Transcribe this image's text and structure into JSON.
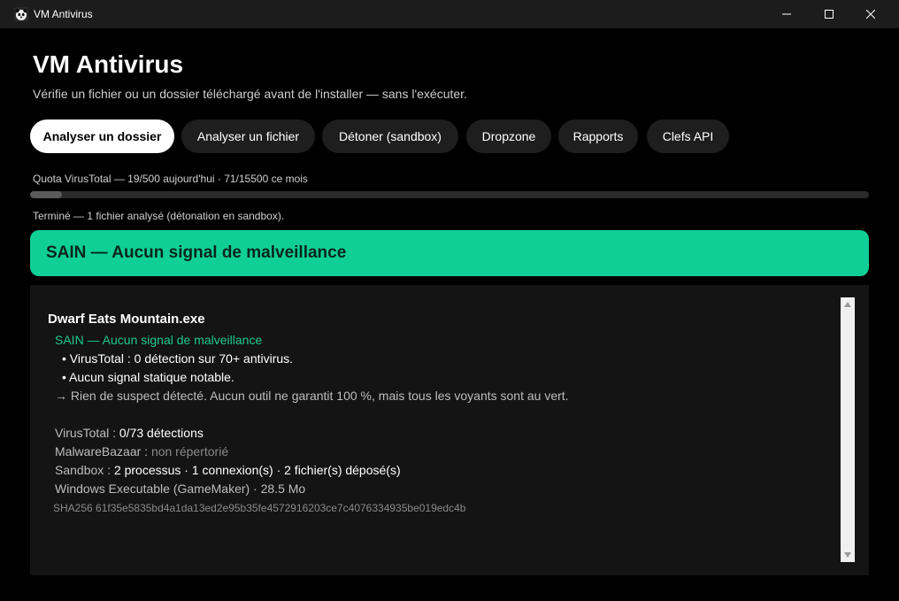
{
  "window": {
    "title": "VM Antivirus",
    "icon": "panda-icon",
    "controls": [
      "minimize-icon",
      "maximize-icon",
      "close-icon"
    ]
  },
  "header": {
    "title": "VM Antivirus",
    "subtitle": "Vérifie un fichier ou un dossier téléchargé avant de l'installer — sans l'exécuter."
  },
  "tabs": [
    {
      "label": "Analyser un dossier",
      "active": true
    },
    {
      "label": "Analyser un fichier",
      "active": false
    },
    {
      "label": "Détoner (sandbox)",
      "active": false
    },
    {
      "label": "Dropzone",
      "active": false
    },
    {
      "label": "Rapports",
      "active": false
    },
    {
      "label": "Clefs API",
      "active": false
    }
  ],
  "quota": {
    "text": "Quota VirusTotal — 19/500 aujourd'hui  ·  71/15500 ce mois",
    "daily_used": 19,
    "daily_limit": 500,
    "monthly_used": 71,
    "monthly_limit": 15500
  },
  "status": "Terminé — 1 fichier analysé (détonation en sandbox).",
  "verdict": {
    "label": "SAIN — Aucun signal de malveillance",
    "color": "#0fcf96"
  },
  "report": {
    "file_name": "Dwarf Eats Mountain.exe",
    "verdict_line": "SAIN — Aucun signal de malveillance",
    "bullets": [
      "• VirusTotal : 0 détection sur 70+ antivirus.",
      "• Aucun signal statique notable."
    ],
    "conclusion": "→ Rien de suspect détecté. Aucun outil ne garantit 100 %, mais tous les voyants sont au vert.",
    "virustotal": {
      "key": "VirusTotal : ",
      "value": "0/73 détections"
    },
    "malwarebazaar": {
      "key": "MalwareBazaar : ",
      "value": "non répertorié"
    },
    "sandbox": {
      "key": "Sandbox : ",
      "value": "2 processus · 1 connexion(s) · 2 fichier(s) déposé(s)"
    },
    "file_type": "Windows Executable (GameMaker) · 28.5 Mo",
    "sha256": "SHA256 61f35e5835bd4a1da13ed2e95b35fe4572916203ce7c4076334935be019edc4b"
  },
  "colors": {
    "background": "#000000",
    "safe_green": "#0fcf96",
    "safe_text": "#1bc98e",
    "panel": "#141414"
  }
}
